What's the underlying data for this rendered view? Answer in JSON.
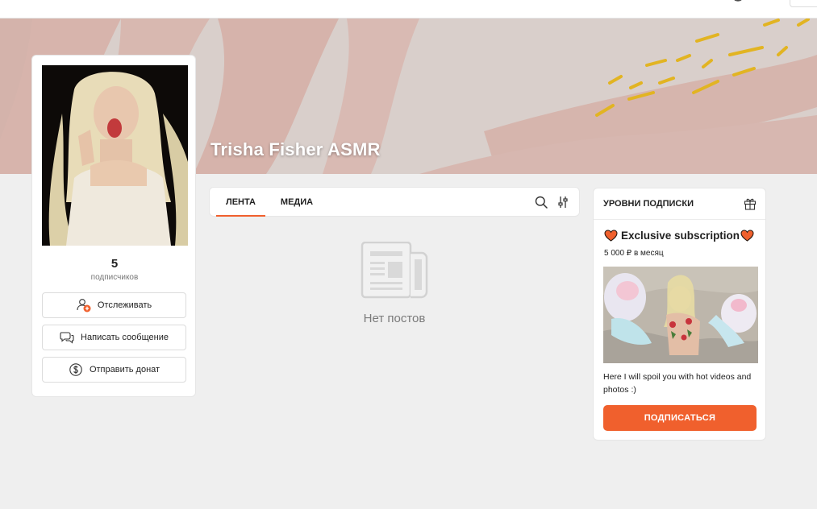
{
  "page": {
    "title": "Trisha Fisher ASMR",
    "accent_color": "#f0602d"
  },
  "profile": {
    "subscribers_count": "5",
    "subscribers_label": "подписчиков",
    "follow_label": "Отслеживать",
    "message_label": "Написать сообщение",
    "donate_label": "Отправить донат"
  },
  "tabs": [
    {
      "label": "ЛЕНТА",
      "active": true
    },
    {
      "label": "МЕДИА",
      "active": false
    }
  ],
  "feed": {
    "empty_text": "Нет постов"
  },
  "subscription": {
    "header": "УРОВНИ ПОДПИСКИ",
    "tier": {
      "name": "Exclusive subscription",
      "price": "5 000 ₽ в месяц",
      "description": "Here I will spoil you with hot videos and photos :)",
      "button_label": "ПОДПИСАТЬСЯ"
    }
  },
  "icons": [
    "globe-icon",
    "add-user-icon",
    "chat-icon",
    "dollar-icon",
    "search-icon",
    "filter-icon",
    "gift-icon",
    "heart-icon",
    "newspaper-icon"
  ]
}
